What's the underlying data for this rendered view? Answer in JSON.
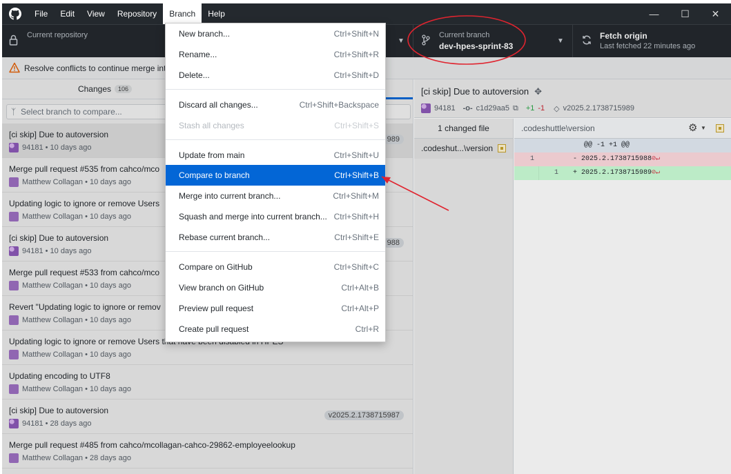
{
  "menubar": {
    "items": [
      "File",
      "Edit",
      "View",
      "Repository",
      "Branch",
      "Help"
    ],
    "active": "Branch"
  },
  "toolbar": {
    "repo_label": "Current repository",
    "branch_label": "Current branch",
    "branch_value": "dev-hpes-sprint-83",
    "fetch_label": "Fetch origin",
    "fetch_sub": "Last fetched 22 minutes ago"
  },
  "banner": {
    "text": "Resolve conflicts to continue merge int"
  },
  "tabs": {
    "changes_label": "Changes",
    "changes_count": "106"
  },
  "compare": {
    "placeholder": "Select branch to compare..."
  },
  "commits": [
    {
      "title": "[ci skip] Due to autoversion",
      "meta": "94181 • 10 days ago",
      "tag": "989"
    },
    {
      "title": "Merge pull request #535 from cahco/mco",
      "meta": "Matthew Collagan • 10 days ago",
      "tag": ""
    },
    {
      "title": "Updating logic to ignore or remove Users",
      "meta": "Matthew Collagan • 10 days ago",
      "tag": ""
    },
    {
      "title": "[ci skip] Due to autoversion",
      "meta": "94181 • 10 days ago",
      "tag": "988"
    },
    {
      "title": "Merge pull request #533 from cahco/mco",
      "meta": "Matthew Collagan • 10 days ago",
      "tag": ""
    },
    {
      "title": "Revert \"Updating logic to ignore or remov",
      "meta": "Matthew Collagan • 10 days ago",
      "tag": ""
    },
    {
      "title": "Updating logic to ignore or remove Users that have been disabled in HPES",
      "meta": "Matthew Collagan • 10 days ago",
      "tag": ""
    },
    {
      "title": "Updating encoding to UTF8",
      "meta": "Matthew Collagan • 10 days ago",
      "tag": ""
    },
    {
      "title": "[ci skip] Due to autoversion",
      "meta": "94181 • 28 days ago",
      "tag": "v2025.2.1738715987"
    },
    {
      "title": "Merge pull request #485 from cahco/mcollagan-cahco-29862-employeelookup",
      "meta": "Matthew Collagan • 28 days ago",
      "tag": ""
    }
  ],
  "commit_detail": {
    "title": "[ci skip] Due to autoversion",
    "author": "94181",
    "sha": "c1d29aa5",
    "diffstat_add": "+1",
    "diffstat_del": "-1",
    "tag": "v2025.2.1738715989",
    "changed_files": "1 changed file",
    "file_short": ".codeshut...\\version",
    "file_path": ".codeshuttle\\version"
  },
  "diff": {
    "hunk": "@@ -1 +1 @@",
    "del_ln": "1",
    "del_code": "-  2025.2.1738715988",
    "add_ln": "1",
    "add_code": "+  2025.2.1738715989"
  },
  "branch_menu": [
    {
      "label": "New branch...",
      "shortcut": "Ctrl+Shift+N",
      "state": "normal"
    },
    {
      "label": "Rename...",
      "shortcut": "Ctrl+Shift+R",
      "state": "normal"
    },
    {
      "label": "Delete...",
      "shortcut": "Ctrl+Shift+D",
      "state": "normal"
    },
    {
      "label": "Discard all changes...",
      "shortcut": "Ctrl+Shift+Backspace",
      "state": "normal"
    },
    {
      "label": "Stash all changes",
      "shortcut": "Ctrl+Shift+S",
      "state": "disabled"
    },
    {
      "label": "Update from main",
      "shortcut": "Ctrl+Shift+U",
      "state": "normal"
    },
    {
      "label": "Compare to branch",
      "shortcut": "Ctrl+Shift+B",
      "state": "highlighted"
    },
    {
      "label": "Merge into current branch...",
      "shortcut": "Ctrl+Shift+M",
      "state": "normal"
    },
    {
      "label": "Squash and merge into current branch...",
      "shortcut": "Ctrl+Shift+H",
      "state": "normal"
    },
    {
      "label": "Rebase current branch...",
      "shortcut": "Ctrl+Shift+E",
      "state": "normal"
    },
    {
      "label": "Compare on GitHub",
      "shortcut": "Ctrl+Shift+C",
      "state": "normal"
    },
    {
      "label": "View branch on GitHub",
      "shortcut": "Ctrl+Alt+B",
      "state": "normal"
    },
    {
      "label": "Preview pull request",
      "shortcut": "Ctrl+Alt+P",
      "state": "normal"
    },
    {
      "label": "Create pull request",
      "shortcut": "Ctrl+R",
      "state": "normal"
    }
  ],
  "colors": {
    "accent": "#0366d6",
    "titlebar": "#24292e",
    "annotation": "#e0242f"
  }
}
